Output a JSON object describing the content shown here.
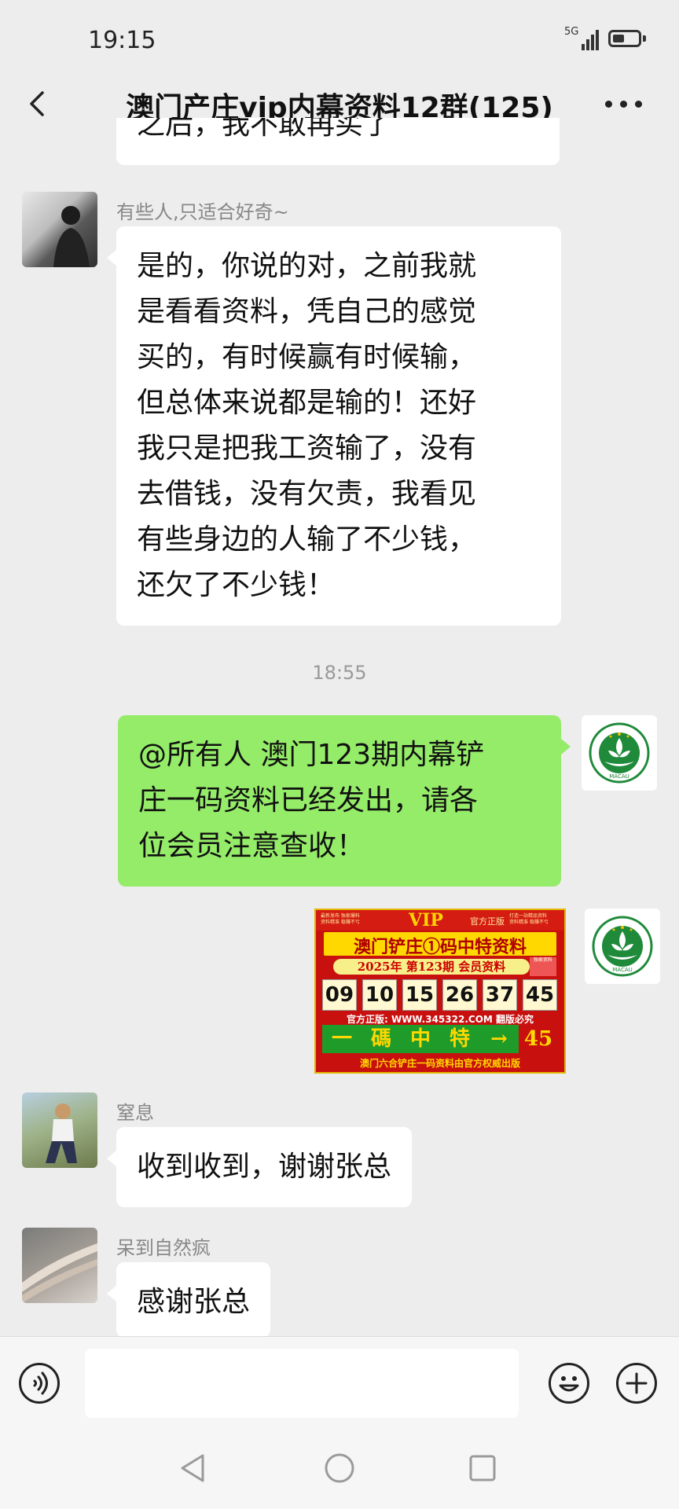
{
  "status_bar": {
    "time": "19:15",
    "network": "5G"
  },
  "header": {
    "title": "澳门产庄vip内幕资料12群(125)"
  },
  "messages": [
    {
      "type": "partial",
      "text": "之后，我不敢再买了"
    },
    {
      "type": "incoming",
      "sender": "有些人,只适合好奇~",
      "lines": [
        "是的，你说的对，之前我就",
        "是看看资料，凭自己的感觉",
        "买的，有时候赢有时候输，",
        "但总体来说都是输的！还好",
        "我只是把我工资输了，没有",
        "去借钱，没有欠责，我看见",
        "有些身边的人输了不少钱，",
        "还欠了不少钱！"
      ]
    },
    {
      "type": "time",
      "text": "18:55"
    },
    {
      "type": "outgoing",
      "lines": [
        "@所有人 澳门123期内幕铲",
        "庄一码资料已经发出，请各",
        "位会员注意查收！"
      ]
    },
    {
      "type": "image"
    },
    {
      "type": "incoming",
      "sender": "窒息",
      "lines": [
        "收到收到，谢谢张总"
      ]
    },
    {
      "type": "incoming",
      "sender": "呆到自然疯",
      "lines": [
        "感谢张总"
      ]
    }
  ],
  "vip_image": {
    "logo": "VIP",
    "tag": "官方正版",
    "small_left": [
      "最新发布  独家爆料",
      "资料精准  稳赚不亏"
    ],
    "small_right": [
      "打造一站精品资料",
      "资料精准  稳赚不亏"
    ],
    "headline": "澳门铲庄①码中特资料",
    "year_line": "2025年 第123期 会员资料",
    "seal": "独家资料",
    "numbers": [
      "09",
      "10",
      "15",
      "26",
      "37",
      "45"
    ],
    "url": "官方正版: WWW.345322.COM 翻版必究",
    "special": [
      "一",
      "碼",
      "中",
      "特",
      "→",
      "45"
    ],
    "footer": "澳门六合铲庄一码资料由官方权威出版"
  },
  "macau_emblem": {
    "text": "MACAU",
    "color": "#1f8a3a"
  }
}
